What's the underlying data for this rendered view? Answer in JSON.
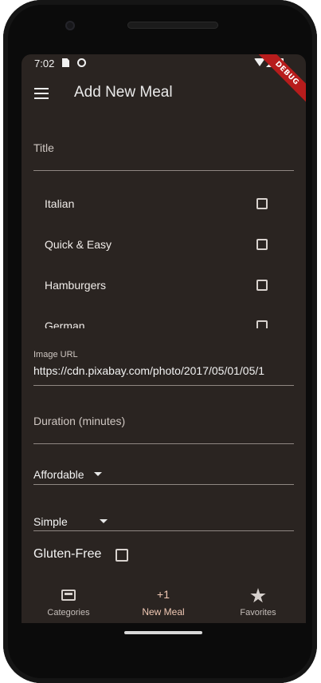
{
  "status_bar": {
    "time": "7:02"
  },
  "debug_banner": "DEBUG",
  "app_bar": {
    "title": "Add New Meal"
  },
  "form": {
    "title_placeholder": "Title",
    "categories": [
      {
        "label": "Italian",
        "checked": false
      },
      {
        "label": "Quick & Easy",
        "checked": false
      },
      {
        "label": "Hamburgers",
        "checked": false
      },
      {
        "label": "German",
        "checked": false
      }
    ],
    "image_url_label": "Image URL",
    "image_url_value": "https://cdn.pixabay.com/photo/2017/05/01/05/1",
    "duration_placeholder": "Duration (minutes)",
    "affordability_value": "Affordable",
    "complexity_value": "Simple",
    "gluten_free_label": "Gluten-Free",
    "gluten_free_checked": false
  },
  "bottom_nav": {
    "categories_label": "Categories",
    "new_meal_icon_text": "+1",
    "new_meal_label": "New Meal",
    "favorites_label": "Favorites",
    "active": "New Meal"
  },
  "colors": {
    "background": "#2a2421",
    "accent": "#f0c8b4",
    "debug_banner": "#b71c1c"
  },
  "icons": [
    "menu-icon",
    "category-icon",
    "star-icon",
    "checkbox-icon",
    "dropdown-caret-icon"
  ]
}
